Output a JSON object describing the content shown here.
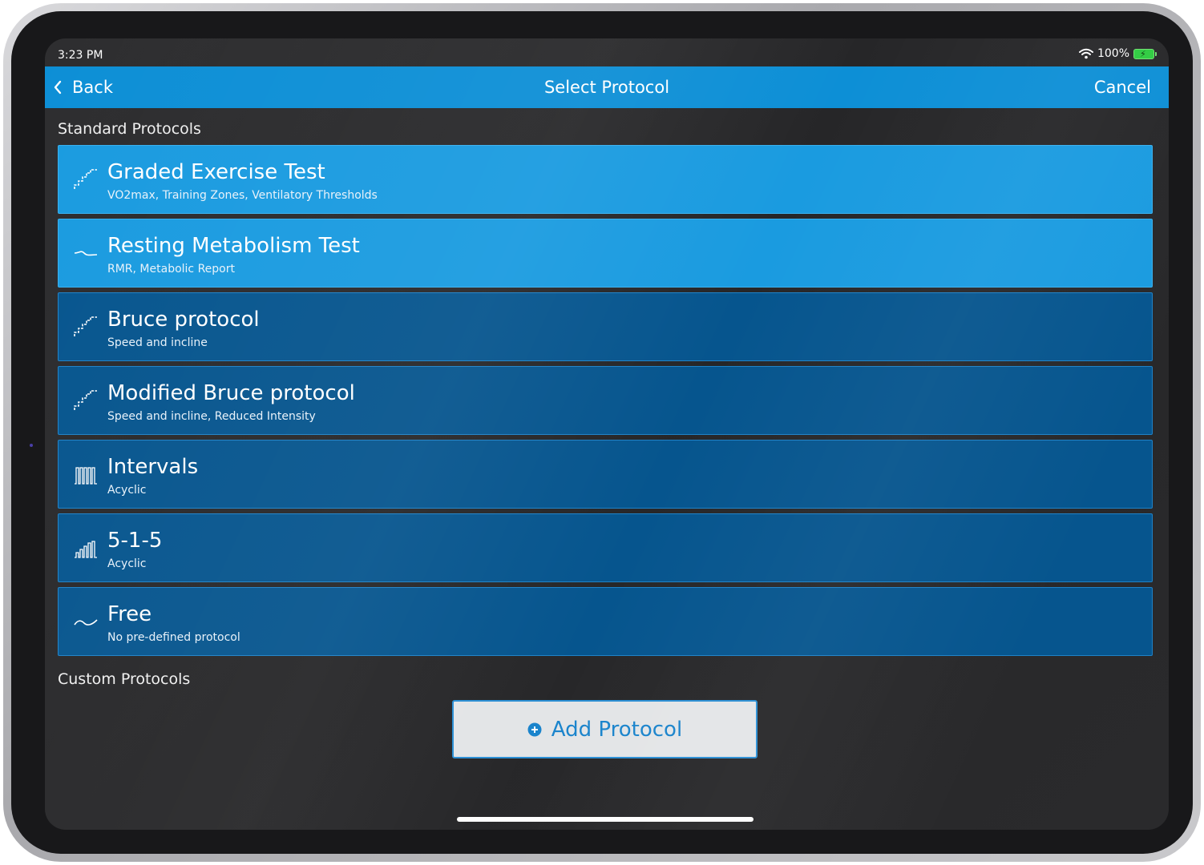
{
  "status_bar": {
    "time": "3:23 PM",
    "battery": "100%"
  },
  "nav": {
    "back_label": "Back",
    "title": "Select Protocol",
    "cancel_label": "Cancel"
  },
  "standard_section": {
    "title": "Standard Protocols",
    "items": [
      {
        "title": "Graded Exercise Test",
        "subtitle": "VO2max, Training Zones, Ventilatory Thresholds",
        "icon": "stairs-icon",
        "selected": true
      },
      {
        "title": "Resting Metabolism Test",
        "subtitle": "RMR, Metabolic Report",
        "icon": "flat-curve-icon",
        "selected": true
      },
      {
        "title": "Bruce protocol",
        "subtitle": "Speed and incline",
        "icon": "stairs-icon",
        "selected": false
      },
      {
        "title": "Modified Bruce protocol",
        "subtitle": "Speed and incline, Reduced Intensity",
        "icon": "stairs-icon",
        "selected": false
      },
      {
        "title": "Intervals",
        "subtitle": "Acyclic",
        "icon": "intervals-icon",
        "selected": false
      },
      {
        "title": "5-1-5",
        "subtitle": "Acyclic",
        "icon": "ramp-intervals-icon",
        "selected": false
      },
      {
        "title": "Free",
        "subtitle": "No pre-defined protocol",
        "icon": "wave-icon",
        "selected": false
      }
    ]
  },
  "custom_section": {
    "title": "Custom Protocols",
    "add_label": "Add Protocol"
  },
  "colors": {
    "nav_blue": "#0d8fd6",
    "row_selected": "#1a9be0",
    "row_normal": "#06558e",
    "button_text": "#1a84cc"
  }
}
